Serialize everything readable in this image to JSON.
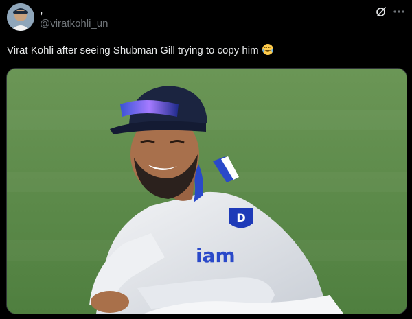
{
  "user": {
    "display_name": ",",
    "handle": "@viratkohli_un"
  },
  "header": {
    "grok_icon": "slash-circle-icon",
    "more_icon": "more-horizontal-icon"
  },
  "tweet": {
    "text": "Virat Kohli after seeing Shubman Gill trying to copy him",
    "emoji": "tears-of-joy-emoji"
  },
  "media": {
    "jersey_text": "iam",
    "badge_text": "D"
  },
  "colors": {
    "background": "#000000",
    "text_primary": "#e7e9ea",
    "text_secondary": "#71767b",
    "grass": "#5b8a4a"
  }
}
